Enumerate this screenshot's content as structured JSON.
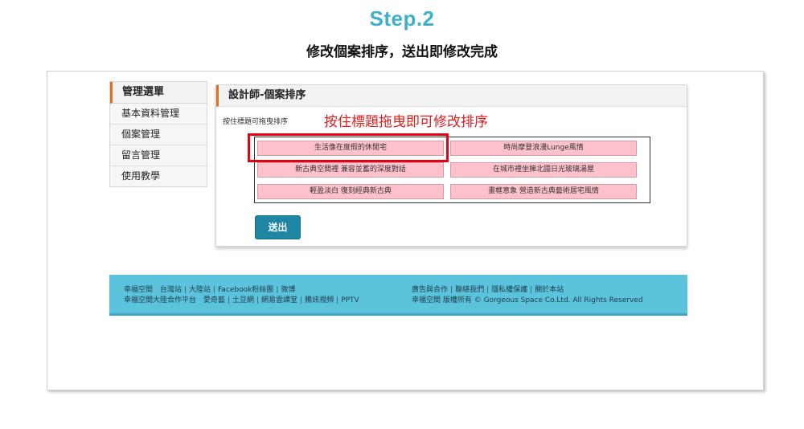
{
  "header": {
    "step": "Step.2",
    "subtitle": "修改個案排序，送出即修改完成"
  },
  "sidebar": {
    "title": "管理選單",
    "items": [
      {
        "label": "基本資料管理"
      },
      {
        "label": "個案管理"
      },
      {
        "label": "留言管理"
      },
      {
        "label": "使用教學"
      }
    ]
  },
  "panel": {
    "title": "設計師-個案排序",
    "hint": "按住標題可拖曳排序",
    "callout": "按住標題拖曳即可修改排序",
    "cases": [
      {
        "label": "生活像在度假的休閒宅"
      },
      {
        "label": "時尚摩登浪漫Lunge風情"
      },
      {
        "label": "新古典空間裡 兼容並蓄的深度對話"
      },
      {
        "label": "在城市裡坐擁北國日光玻璃湯屋"
      },
      {
        "label": "輕盈淡白 復刻經典新古典"
      },
      {
        "label": "畫框意象 營造新古典藝術居宅風情"
      }
    ],
    "submit_label": "送出"
  },
  "footer": {
    "left_row1": [
      "幸福空間",
      "台灣站",
      "大陸站",
      "Facebook粉絲團",
      "微博"
    ],
    "left_row2": [
      "幸福空間大陸合作平台",
      "愛奇藝",
      "土豆網",
      "網易雲課堂",
      "騰訊視頻",
      "PPTV"
    ],
    "right_row1": [
      "廣告與合作",
      "聯絡我們",
      "隱私權保護",
      "關於本站"
    ],
    "right_row2": "幸福空間  版權所有 © Gorgeous Space Co.Ltd. All Rights Reserved"
  },
  "colors": {
    "accent": "#3fb0c9",
    "orange_marker": "#e46f1e",
    "callout_red": "#e11d1d",
    "card_pink": "#ffc2cc",
    "button_blue": "#1e86a3",
    "footer_blue": "#5bc3dc"
  }
}
